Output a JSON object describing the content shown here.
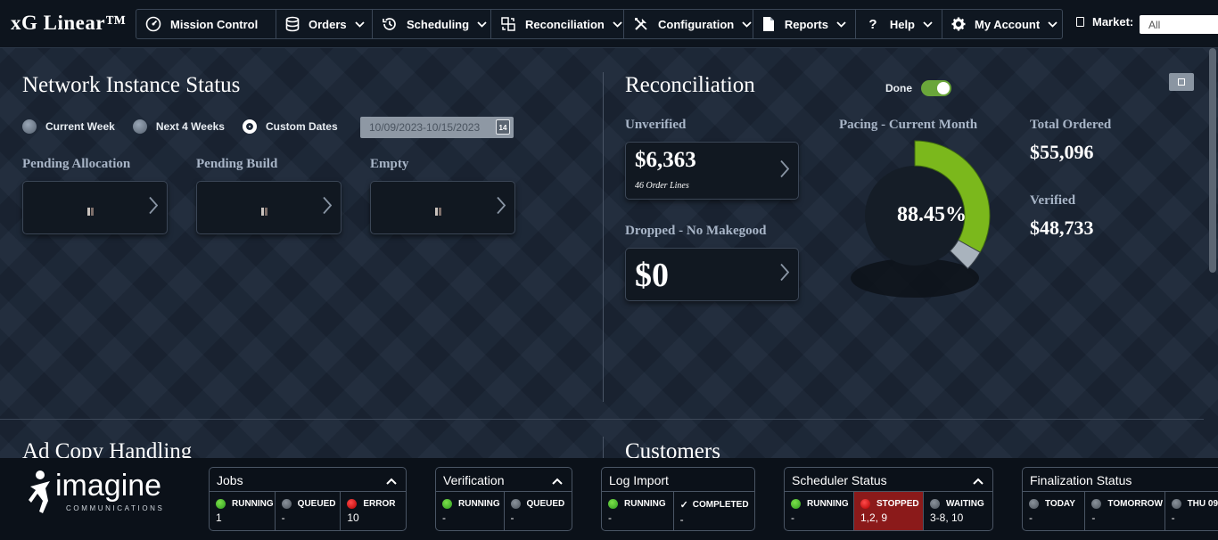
{
  "app": {
    "title": "xG Linear™"
  },
  "nav": {
    "items": [
      {
        "label": "Mission Control",
        "icon": "dashboard-gauge-icon",
        "dropdown": false
      },
      {
        "label": "Orders",
        "icon": "database-stack-icon",
        "dropdown": true
      },
      {
        "label": "Scheduling",
        "icon": "clock-history-icon",
        "dropdown": true
      },
      {
        "label": "Reconciliation",
        "icon": "reconcile-squares-icon",
        "dropdown": true
      },
      {
        "label": "Configuration",
        "icon": "tools-icon",
        "dropdown": true
      },
      {
        "label": "Reports",
        "icon": "document-icon",
        "dropdown": true
      },
      {
        "label": "Help",
        "icon": "question-icon",
        "dropdown": true
      },
      {
        "label": "My Account",
        "icon": "gear-icon",
        "dropdown": true
      }
    ],
    "market_label": "Market:",
    "market_value": "All"
  },
  "network_status": {
    "title": "Network Instance Status",
    "radios": [
      {
        "label": "Current Week",
        "selected": false
      },
      {
        "label": "Next 4 Weeks",
        "selected": false
      },
      {
        "label": "Custom Dates",
        "selected": true
      }
    ],
    "date_range": "10/09/2023-10/15/2023",
    "calendar_icon_text": "14",
    "cards": [
      {
        "label": "Pending Allocation"
      },
      {
        "label": "Pending Build"
      },
      {
        "label": "Empty"
      }
    ]
  },
  "reconciliation": {
    "title": "Reconciliation",
    "done_label": "Done",
    "done_on": true,
    "unverified_label": "Unverified",
    "unverified_value": "$6,363",
    "unverified_sub": "46 Order Lines",
    "dropped_label": "Dropped - No Makegood",
    "dropped_value": "$0",
    "pacing_label": "Pacing - Current Month",
    "pacing_value": "88.45%",
    "pacing_fraction": 0.8845,
    "total_ordered_label": "Total Ordered",
    "total_ordered_value": "$55,096",
    "verified_label": "Verified",
    "verified_value": "$48,733",
    "colors": {
      "pacing_fill": "#7bb81c",
      "pacing_remainder": "#a9b3bd",
      "toggle_on": "#6aa63a"
    }
  },
  "lower_sections": {
    "ad_copy_title": "Ad Copy Handling",
    "customers_title": "Customers"
  },
  "statusbar": {
    "logo_text": "imagine",
    "logo_sub": "COMMUNICATIONS",
    "panels": {
      "jobs": {
        "title": "Jobs",
        "cells": [
          {
            "label": "RUNNING",
            "value": "1",
            "led": "green"
          },
          {
            "label": "QUEUED",
            "value": "-",
            "led": "grey"
          },
          {
            "label": "ERROR",
            "value": "10",
            "led": "red"
          }
        ]
      },
      "verification": {
        "title": "Verification",
        "cells": [
          {
            "label": "RUNNING",
            "value": "-",
            "led": "green"
          },
          {
            "label": "QUEUED",
            "value": "-",
            "led": "grey"
          }
        ]
      },
      "log_import": {
        "title": "Log Import",
        "cells": [
          {
            "label": "RUNNING",
            "value": "-",
            "led": "green"
          },
          {
            "label": "COMPLETED",
            "value": "-",
            "led": "check"
          }
        ]
      },
      "scheduler": {
        "title": "Scheduler Status",
        "cells": [
          {
            "label": "RUNNING",
            "value": "-",
            "led": "green"
          },
          {
            "label": "STOPPED",
            "value": "1,2, 9",
            "led": "red"
          },
          {
            "label": "WAITING",
            "value": "3-8, 10",
            "led": "grey"
          }
        ]
      },
      "finalization": {
        "title": "Finalization Status",
        "cells": [
          {
            "label": "TODAY",
            "value": "-",
            "led": "grey"
          },
          {
            "label": "TOMORROW",
            "value": "-",
            "led": "grey"
          },
          {
            "label": "THU 09",
            "value": "-",
            "led": "grey"
          }
        ]
      }
    }
  }
}
